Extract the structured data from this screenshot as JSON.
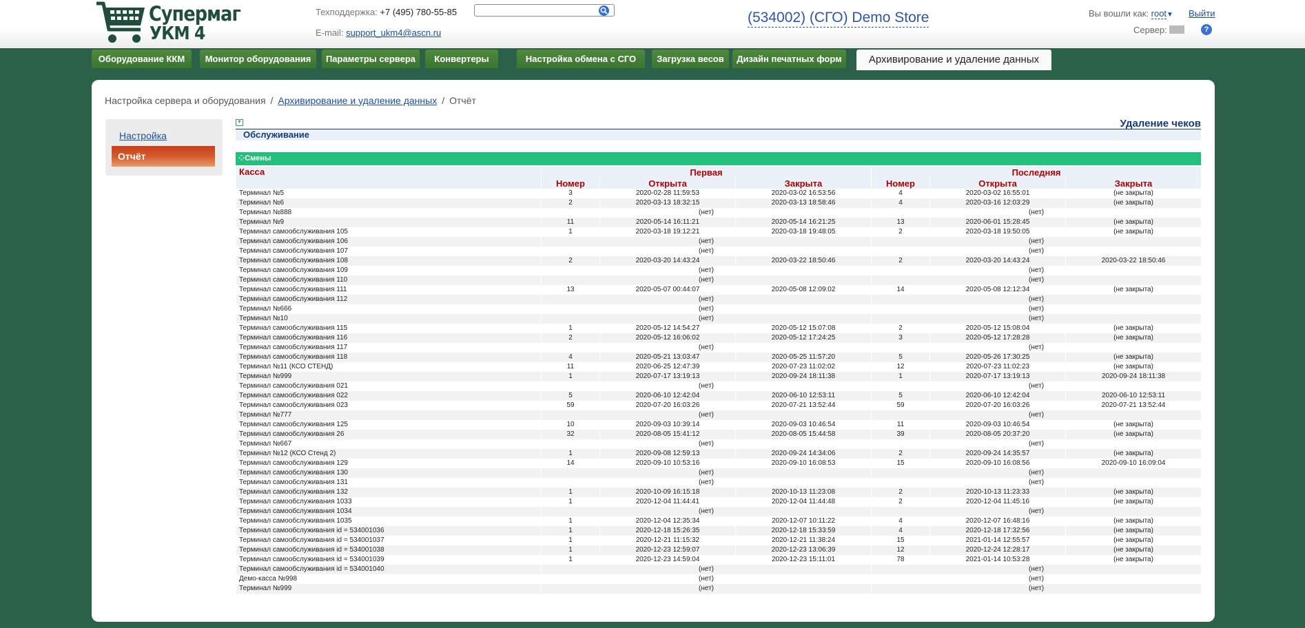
{
  "header": {
    "logo_line1": "Супермаг",
    "logo_line2": "УКМ 4",
    "support_label": "Техподдержка:",
    "support_phone": "+7 (495) 780-55-85",
    "email_label": "E-mail:",
    "email": "support_ukm4@ascn.ru",
    "search_value": "",
    "store_title": "(534002) (СГО) Demo Store",
    "logged_as_label": "Вы вошли как:",
    "user": "root",
    "logout": "Выйти",
    "server_label": "Сервер:",
    "help": "?"
  },
  "tabs": [
    {
      "label": "Оборудование ККМ"
    },
    {
      "label": "Монитор оборудования"
    },
    {
      "label": "Параметры сервера"
    },
    {
      "label": "Конвертеры"
    },
    {
      "label": "Настройка обмена с СГО"
    },
    {
      "label": "Загрузка весов"
    },
    {
      "label": "Дизайн печатных форм"
    },
    {
      "label": "Архивирование и удаление данных",
      "active": true
    }
  ],
  "breadcrumb": {
    "root": "Настройка сервера и оборудования",
    "middle": "Архивирование и удаление данных",
    "current": "Отчёт",
    "separator": "/"
  },
  "leftnav": {
    "link": "Настройка",
    "active": "Отчёт"
  },
  "report": {
    "right_title": "Удаление чеков",
    "section_title": "Обслуживание",
    "shifts_title": "Смены",
    "col_kassa": "Касса",
    "col_first": "Первая",
    "col_last": "Последняя",
    "col_number": "Номер",
    "col_opened": "Открыта",
    "col_closed": "Закрыта",
    "rows": [
      [
        "Терминал №5",
        "3",
        "2020-02-28 11:59:53",
        "2020-03-02 16:53:56",
        "4",
        "2020-03-02 16:55:01",
        "(не закрыта)"
      ],
      [
        "Терминал №6",
        "2",
        "2020-03-13 18:32:15",
        "2020-03-13 18:58:46",
        "4",
        "2020-03-16 12:03:29",
        "(не закрыта)"
      ],
      [
        "Терминал №888",
        "(нет)",
        "(нет)"
      ],
      [
        "Терминал №9",
        "11",
        "2020-05-14 16:11:21",
        "2020-05-14 16:21:25",
        "13",
        "2020-06-01 15:28:45",
        "(не закрыта)"
      ],
      [
        "Терминал самообслуживания 105",
        "1",
        "2020-03-18 19:12:21",
        "2020-03-18 19:48:05",
        "2",
        "2020-03-18 19:50:05",
        "(не закрыта)"
      ],
      [
        "Терминал самообслуживания 106",
        "(нет)",
        "(нет)"
      ],
      [
        "Терминал самообслуживания 107",
        "(нет)",
        "(нет)"
      ],
      [
        "Терминал самообслуживания 108",
        "2",
        "2020-03-20 14:43:24",
        "2020-03-22 18:50:46",
        "2",
        "2020-03-20 14:43:24",
        "2020-03-22 18:50:46"
      ],
      [
        "Терминал самообслуживания 109",
        "(нет)",
        "(нет)"
      ],
      [
        "Терминал самообслуживания 110",
        "(нет)",
        "(нет)"
      ],
      [
        "Терминал самообслуживания 111",
        "13",
        "2020-05-07 00:44:07",
        "2020-05-08 12:09:02",
        "14",
        "2020-05-08 12:12:34",
        "(не закрыта)"
      ],
      [
        "Терминал самообслуживания 112",
        "(нет)",
        "(нет)"
      ],
      [
        "Терминал №666",
        "(нет)",
        "(нет)"
      ],
      [
        "Терминал №10",
        "(нет)",
        "(нет)"
      ],
      [
        "Терминал самообслуживания 115",
        "1",
        "2020-05-12 14:54:27",
        "2020-05-12 15:07:08",
        "2",
        "2020-05-12 15:08:04",
        "(не закрыта)"
      ],
      [
        "Терминал самообслуживания 116",
        "2",
        "2020-05-12 16:06:02",
        "2020-05-12 17:24:25",
        "3",
        "2020-05-12 17:28:28",
        "(не закрыта)"
      ],
      [
        "Терминал самообслуживания 117",
        "(нет)",
        "(нет)"
      ],
      [
        "Терминал самообслуживания 118",
        "4",
        "2020-05-21 13:03:47",
        "2020-05-25 11:57:20",
        "5",
        "2020-05-26 17:30:25",
        "(не закрыта)"
      ],
      [
        "Терминал №11 (КСО СТЕНД)",
        "11",
        "2020-06-25 12:47:39",
        "2020-07-23 11:02:02",
        "12",
        "2020-07-23 11:02:23",
        "(не закрыта)"
      ],
      [
        "Терминал №999",
        "1",
        "2020-07-17 13:19:13",
        "2020-09-24 18:11:38",
        "1",
        "2020-07-17 13:19:13",
        "2020-09-24 18:11:38"
      ],
      [
        "Терминал самообслуживания 021",
        "(нет)",
        "(нет)"
      ],
      [
        "Терминал самообслуживания 022",
        "5",
        "2020-06-10 12:42:04",
        "2020-06-10 12:53:11",
        "5",
        "2020-06-10 12:42:04",
        "2020-06-10 12:53:11"
      ],
      [
        "Терминал самообслуживания 023",
        "59",
        "2020-07-20 16:03:26",
        "2020-07-21 13:52:44",
        "59",
        "2020-07-20 16:03:26",
        "2020-07-21 13:52:44"
      ],
      [
        "Терминал №777",
        "(нет)",
        "(нет)"
      ],
      [
        "Терминал самообслуживания 125",
        "10",
        "2020-09-03 10:39:14",
        "2020-09-03 10:46:54",
        "11",
        "2020-09-03 10:46:54",
        "(не закрыта)"
      ],
      [
        "Терминал самообслуживания 26",
        "32",
        "2020-08-05 15:41:12",
        "2020-08-05 15:44:58",
        "39",
        "2020-08-05 20:37:20",
        "(не закрыта)"
      ],
      [
        "Терминал №667",
        "(нет)",
        "(нет)"
      ],
      [
        "Терминал №12 (КСО Стенд 2)",
        "1",
        "2020-09-08 12:59:13",
        "2020-09-24 14:34:06",
        "2",
        "2020-09-24 14:35:57",
        "(не закрыта)"
      ],
      [
        "Терминал самообслуживания 129",
        "14",
        "2020-09-10 10:53:16",
        "2020-09-10 16:08:53",
        "15",
        "2020-09-10 16:08:56",
        "2020-09-10 16:09:04"
      ],
      [
        "Терминал самообслуживания 130",
        "(нет)",
        "(нет)"
      ],
      [
        "Терминал самообслуживания 131",
        "(нет)",
        "(нет)"
      ],
      [
        "Терминал самообслуживания 132",
        "1",
        "2020-10-09 16:15:18",
        "2020-10-13 11:23:08",
        "2",
        "2020-10-13 11:23:33",
        "(не закрыта)"
      ],
      [
        "Терминал самообслуживания 1033",
        "1",
        "2020-12-04 11:44:41",
        "2020-12-04 11:44:48",
        "2",
        "2020-12-04 11:45:16",
        "(не закрыта)"
      ],
      [
        "Терминал самообслуживания 1034",
        "(нет)",
        "(нет)"
      ],
      [
        "Терминал самообслуживания 1035",
        "1",
        "2020-12-04 12:35:34",
        "2020-12-07 10:11:22",
        "4",
        "2020-12-07 16:48:16",
        "(не закрыта)"
      ],
      [
        "Терминал самообслуживания id = 534001036",
        "1",
        "2020-12-18 15:26:35",
        "2020-12-18 15:33:59",
        "4",
        "2020-12-18 17:32:56",
        "(не закрыта)"
      ],
      [
        "Терминал самообслуживания id = 534001037",
        "1",
        "2020-12-21 11:15:32",
        "2020-12-21 11:38:24",
        "15",
        "2021-01-14 12:55:57",
        "(не закрыта)"
      ],
      [
        "Терминал самообслуживания id = 534001038",
        "1",
        "2020-12-23 12:59:07",
        "2020-12-23 13:06:39",
        "12",
        "2020-12-24 12:28:17",
        "(не закрыта)"
      ],
      [
        "Терминал самообслуживания id = 534001039",
        "1",
        "2020-12-23 14:59:04",
        "2020-12-23 15:11:01",
        "78",
        "2021-01-14 10:53:28",
        "(не закрыта)"
      ],
      [
        "Терминал самообслуживания id = 534001040",
        "(нет)",
        "(нет)"
      ],
      [
        "Демо-касса №998",
        "(нет)",
        "(нет)"
      ],
      [
        "Терминал №999",
        "(нет)",
        "(нет)"
      ]
    ]
  }
}
